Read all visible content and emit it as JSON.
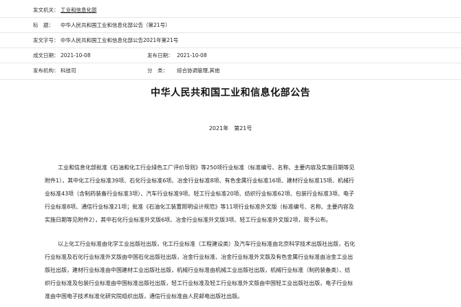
{
  "meta": {
    "issuer_label": "发文机关：",
    "issuer_value": "工业和信息化部",
    "title_label": "标　题：",
    "title_value": "中华人民共和国工业和信息化部公告（第21号）",
    "docno_label": "发文字号：",
    "docno_value": "中华人民共和国工业和信息化部公告2021年第21号",
    "created_label": "成文日期：",
    "created_value": "2021-10-08",
    "published_label": "发布日期：",
    "published_value": "2021-10-08",
    "org_label": "发布机构：",
    "org_value": "科技司",
    "category_label": "分　类：",
    "category_value": "综合协调管理,其他"
  },
  "document": {
    "title": "中华人民共和国工业和信息化部公告",
    "number": "2021年　第21号",
    "paragraph1_lines": [
      "工业和信息化部批准《石油和化工行业绿色工厂评价导则》等250项行业标准（标准编号、名称、主要内容及实施日期等见",
      "附件1），其中化工行业标准39项、石化行业标准6项、冶金行业标准8项、有色金属行业标准16项、建材行业标准15项、机械行",
      "业标准43项（含制药装备行业标准3项）、汽车行业标准9项、轻工行业标准20项、纺织行业标准62项、包装行业标准3项、电子",
      "行业标准8项、通信行业标准21项；批准《石油化工装置照明设计规范》等11项行业标准外文版（标准编号、名称、主要内容及",
      "实施日期等见附件2），其中石化行业标准外文版6项、冶金行业标准外文版3项、轻工行业标准外文版2项，现予公布。"
    ],
    "paragraph2_lines": [
      "以上化工行业标准由化学工业出版社出版，化工行业标准（工程建设类）及汽车行业标准由北京科学技术出版社出版，石化",
      "行业标准及石化行业标准外文版由中国石化出版社出版，冶金行业标准、冶金行业标准外文版及有色金属行业标准由冶金工业出",
      "版社出版，建材行业标准由中国建材工业出版社出版，机械行业标准由机械工业出版社出版，机械行业标准（制药装备类）、纺",
      "织行业标准及包装行业标准由中国标准出版社出版，轻工行业标准及轻工行业标准外文版由中国轻工业出版社出版，电子行业标",
      "准由中国电子技术标准化研究院组织出版，通信行业标准由人民邮电出版社出版。"
    ]
  }
}
